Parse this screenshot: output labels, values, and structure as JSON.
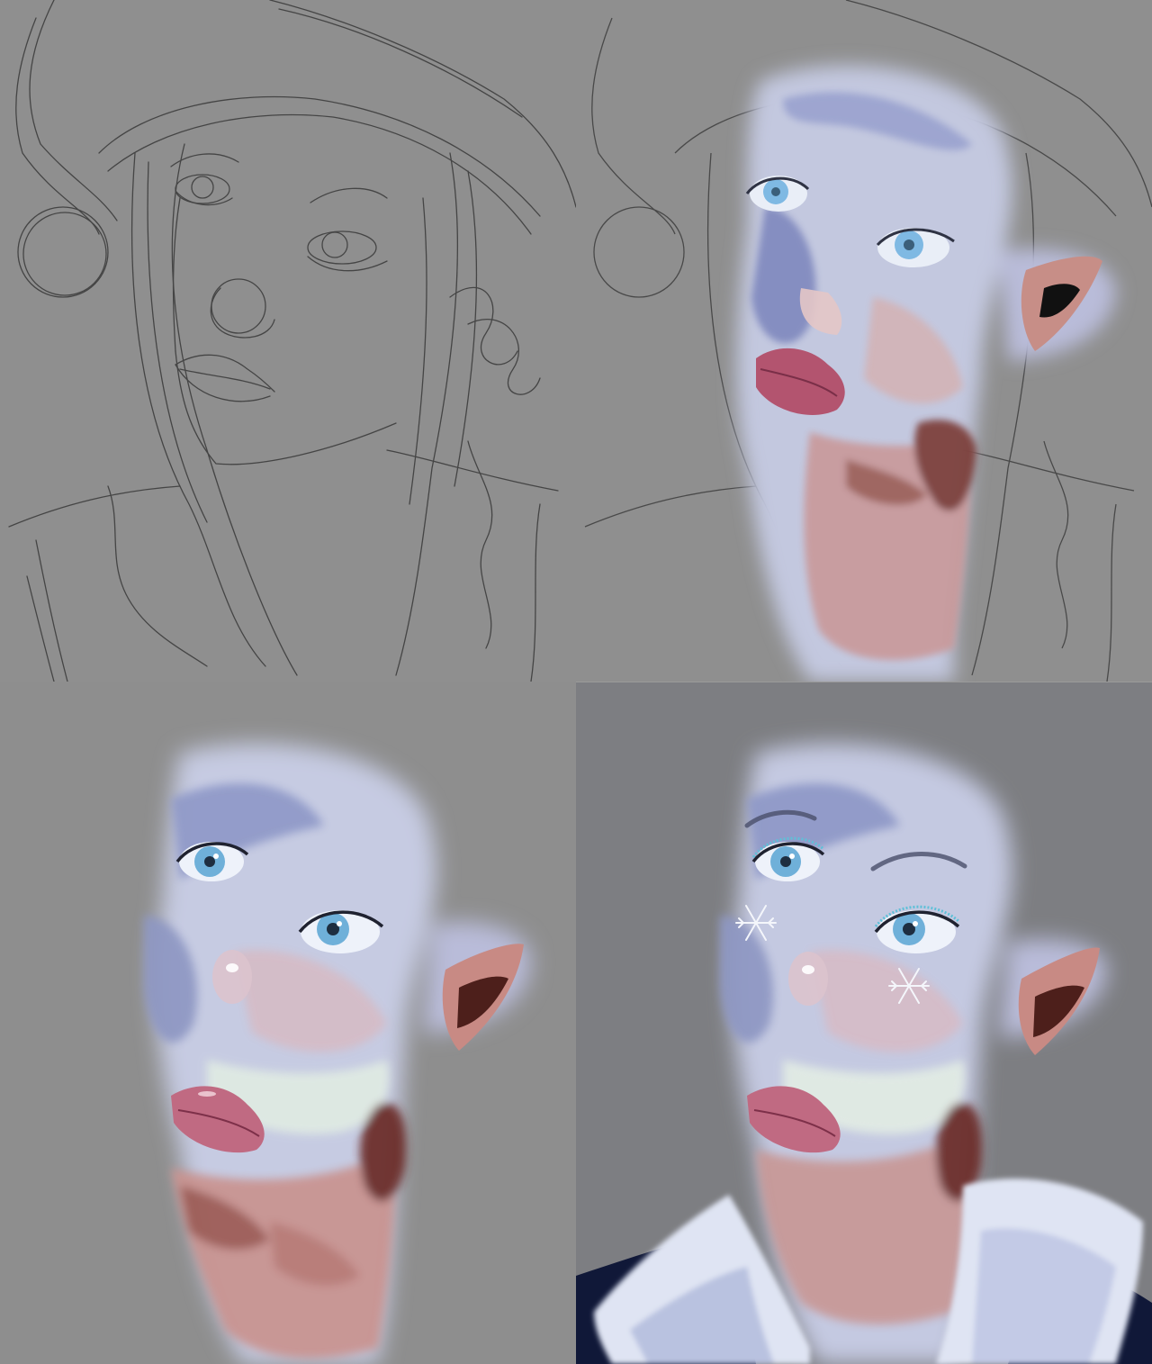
{
  "stages": [
    {
      "name": "sketch"
    },
    {
      "name": "base-colors"
    },
    {
      "name": "refined-rendering"
    },
    {
      "name": "final"
    }
  ],
  "colors": {
    "background": "#8e8e8e",
    "final_background": "#7d7e82",
    "skin_light": "#cdd3e6",
    "skin_blue": "#8f99c8",
    "skin_pink": "#c98f92",
    "skin_shadow": "#7a3a36",
    "lips": "#b3546f",
    "iris": "#6fb0d9",
    "fur": "#dfe4f3",
    "coat": "#101838",
    "line": "#3b3b3b"
  }
}
